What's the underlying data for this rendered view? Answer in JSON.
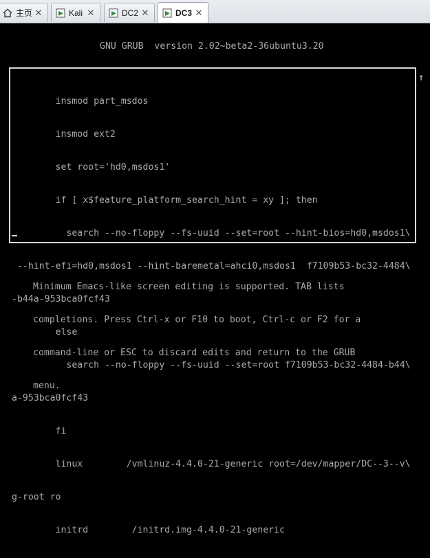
{
  "tabs": [
    {
      "label": "主页",
      "icon": "home-icon"
    },
    {
      "label": "Kali",
      "icon": "vm-icon"
    },
    {
      "label": "DC2",
      "icon": "vm-icon"
    },
    {
      "label": "DC3",
      "icon": "vm-icon",
      "active": true
    }
  ],
  "close_glyph": "✕",
  "grub": {
    "header": "GNU GRUB  version 2.02~beta2-36ubuntu3.20",
    "lines": [
      "        insmod part_msdos",
      "        insmod ext2",
      "        set root='hd0,msdos1'",
      "        if [ x$feature_platform_search_hint = xy ]; then",
      "          search --no-floppy --fs-uuid --set=root --hint-bios=hd0,msdos1\\",
      " --hint-efi=hd0,msdos1 --hint-baremetal=ahci0,msdos1  f7109b53-bc32-4484\\",
      "-b44a-953bca0fcf43",
      "        else",
      "          search --no-floppy --fs-uuid --set=root f7109b53-bc32-4484-b44\\",
      "a-953bca0fcf43",
      "        fi",
      "        linux        /vmlinuz-4.4.0-21-generic root=/dev/mapper/DC--3--v\\",
      "g-root ro",
      "        initrd        /initrd.img-4.4.0-21-generic"
    ],
    "scroll_up_glyph": "↑",
    "help_lines": [
      "Minimum Emacs-like screen editing is supported. TAB lists",
      "completions. Press Ctrl-x or F10 to boot, Ctrl-c or F2 for a",
      "command-line or ESC to discard edits and return to the GRUB",
      "menu."
    ]
  }
}
